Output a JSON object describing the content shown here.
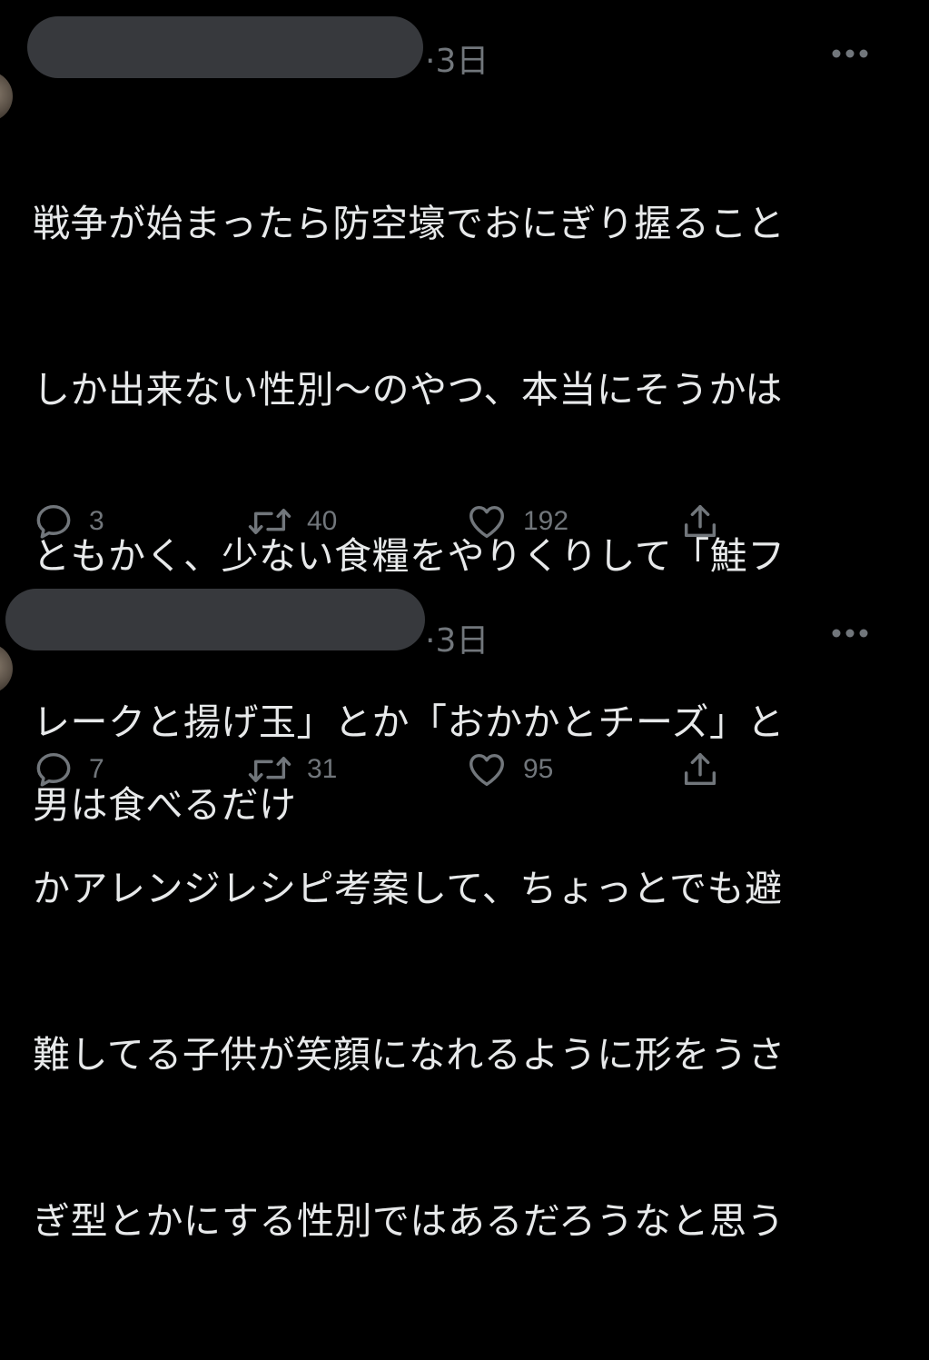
{
  "tweets": [
    {
      "time": "·3日",
      "lines": [
        "戦争が始まったら防空壕でおにぎり握ること",
        "しか出来ない性別〜のやつ、本当にそうかは",
        "ともかく、少ない食糧をやりくりして「鮭フ",
        "レークと揚げ玉」とか「おかかとチーズ」と",
        "かアレンジレシピ考案して、ちょっとでも避",
        "難してる子供が笑顔になれるように形をうさ",
        "ぎ型とかにする性別ではあるだろうなと思う"
      ],
      "replies": "3",
      "retweets": "40",
      "likes": "192"
    },
    {
      "time": "·3日",
      "lines": [
        "男は食べるだけ"
      ],
      "replies": "7",
      "retweets": "31",
      "likes": "95"
    }
  ],
  "icons": {
    "reply": "reply-icon",
    "retweet": "retweet-icon",
    "like": "like-icon",
    "share": "share-icon",
    "more": "more-icon"
  },
  "colors": {
    "background": "#000000",
    "text": "#e7e9ea",
    "muted": "#71767b",
    "redaction": "#37393d"
  }
}
